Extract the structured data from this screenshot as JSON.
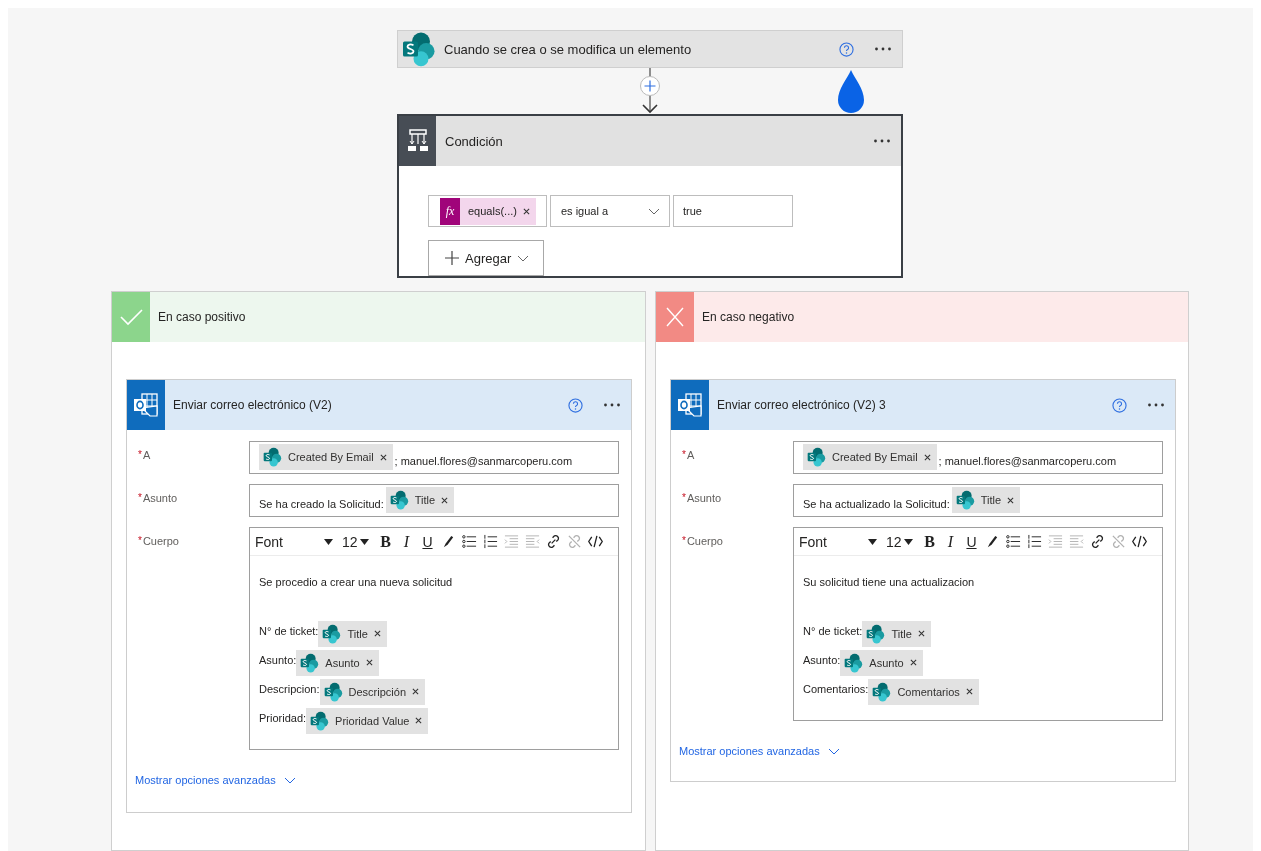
{
  "trigger": {
    "title": "Cuando se crea o se modifica un elemento"
  },
  "condition": {
    "title": "Condición",
    "operand": {
      "icon": "fx",
      "label": "equals(...)"
    },
    "operator": "es igual a",
    "value": "true",
    "add_button": "Agregar"
  },
  "branches": [
    {
      "kind": "yes",
      "title": "En caso positivo",
      "action": {
        "title": "Enviar correo electrónico (V2)",
        "fields": [
          {
            "kind": "line",
            "mark": "*",
            "label": "A",
            "parts": [
              {
                "kind": "token",
                "label": "Created By Email"
              },
              {
                "kind": "text",
                "text": "; manuel.flores@sanmarcoperu.com"
              }
            ]
          },
          {
            "kind": "line",
            "mark": "*",
            "label": "Asunto",
            "parts": [
              {
                "kind": "text",
                "text": "Se ha creado la Solicitud:"
              },
              {
                "kind": "token",
                "label": "Title"
              }
            ]
          },
          {
            "kind": "editor",
            "mark": "*",
            "label": "Cuerpo",
            "font": "Font",
            "size": "12",
            "tools": [
              {
                "kind": "bold",
                "label": "B",
                "disabled": false
              },
              {
                "kind": "italic",
                "label": "I",
                "disabled": false
              },
              {
                "kind": "underline",
                "label": "U",
                "disabled": false
              },
              {
                "kind": "pen",
                "disabled": false
              },
              {
                "kind": "bullets",
                "disabled": false
              },
              {
                "kind": "numbers",
                "disabled": false
              },
              {
                "kind": "outdent",
                "disabled": true
              },
              {
                "kind": "indent",
                "disabled": true
              },
              {
                "kind": "link",
                "disabled": false
              },
              {
                "kind": "unlink",
                "disabled": true
              },
              {
                "kind": "code",
                "disabled": false
              }
            ],
            "intro": "Se procedio a crear una nueva solicitud",
            "lines": [
              {
                "text": "N° de ticket:",
                "token": "Title"
              },
              {
                "text": "Asunto:",
                "token": "Asunto"
              },
              {
                "text": "Descripcion:",
                "token": "Descripción"
              },
              {
                "text": "Prioridad:",
                "token": "Prioridad Value"
              }
            ]
          }
        ],
        "advanced_link": "Mostrar opciones avanzadas"
      }
    },
    {
      "kind": "no",
      "title": "En caso negativo",
      "action": {
        "title": "Enviar correo electrónico (V2) 3",
        "fields": [
          {
            "kind": "line",
            "mark": "*",
            "label": "A",
            "parts": [
              {
                "kind": "token",
                "label": "Created By Email"
              },
              {
                "kind": "text",
                "text": "; manuel.flores@sanmarcoperu.com"
              }
            ]
          },
          {
            "kind": "line",
            "mark": "*",
            "label": "Asunto",
            "parts": [
              {
                "kind": "text",
                "text": "Se ha actualizado la Solicitud:"
              },
              {
                "kind": "token",
                "label": "Title"
              }
            ]
          },
          {
            "kind": "editor",
            "mark": "*",
            "label": "Cuerpo",
            "font": "Font",
            "size": "12",
            "tools": [
              {
                "kind": "bold",
                "label": "B",
                "disabled": false
              },
              {
                "kind": "italic",
                "label": "I",
                "disabled": false
              },
              {
                "kind": "underline",
                "label": "U",
                "disabled": false
              },
              {
                "kind": "pen",
                "disabled": false
              },
              {
                "kind": "bullets",
                "disabled": false
              },
              {
                "kind": "numbers",
                "disabled": false
              },
              {
                "kind": "outdent",
                "disabled": true
              },
              {
                "kind": "indent",
                "disabled": true
              },
              {
                "kind": "link",
                "disabled": false
              },
              {
                "kind": "unlink",
                "disabled": true
              },
              {
                "kind": "code",
                "disabled": false
              }
            ],
            "intro": "Su solicitud tiene una actualizacion",
            "lines": [
              {
                "text": "N° de ticket:",
                "token": "Title"
              },
              {
                "text": "Asunto:",
                "token": "Asunto"
              },
              {
                "text": "Comentarios:",
                "token": "Comentarios"
              }
            ]
          }
        ],
        "advanced_link": "Mostrar opciones avanzadas"
      }
    }
  ]
}
